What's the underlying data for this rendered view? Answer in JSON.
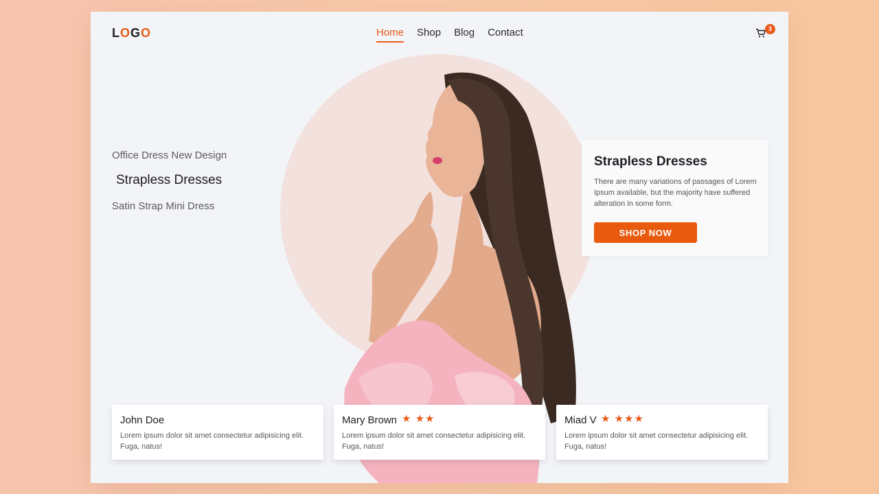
{
  "header": {
    "logo": {
      "l": "L",
      "o1": "O",
      "g": "G",
      "o2": "O"
    },
    "nav": [
      "Home",
      "Shop",
      "Blog",
      "Contact"
    ],
    "cart_count": "3"
  },
  "side_list": [
    "Office Dress New Design",
    "Strapless Dresses",
    "Satin Strap Mini Dress"
  ],
  "promo": {
    "title": "Strapless Dresses",
    "text": "There are many variations of passages of Lorem Ipsum available, but the majority have suffered alteration in some form.",
    "button": "SHOP NOW"
  },
  "reviews": [
    {
      "name": "John Doe",
      "stars": "",
      "text": "Lorem ipsum dolor sit amet consectetur adipisicing elit. Fuga, natus!"
    },
    {
      "name": "Mary Brown",
      "stars": "★ ★★",
      "text": "Lorem ipsum dolor sit amet consectetur adipisicing elit. Fuga, natus!"
    },
    {
      "name": "Miad V",
      "stars": "★ ★★★",
      "text": "Lorem ipsum dolor sit amet consectetur adipisicing elit. Fuga, natus!"
    }
  ],
  "colors": {
    "accent": "#e85a17",
    "background": "#f2f4f7",
    "circle": "#f3e1dd",
    "dress": "#f5b3bf"
  },
  "icons": [
    "cart-icon",
    "star-icon"
  ]
}
